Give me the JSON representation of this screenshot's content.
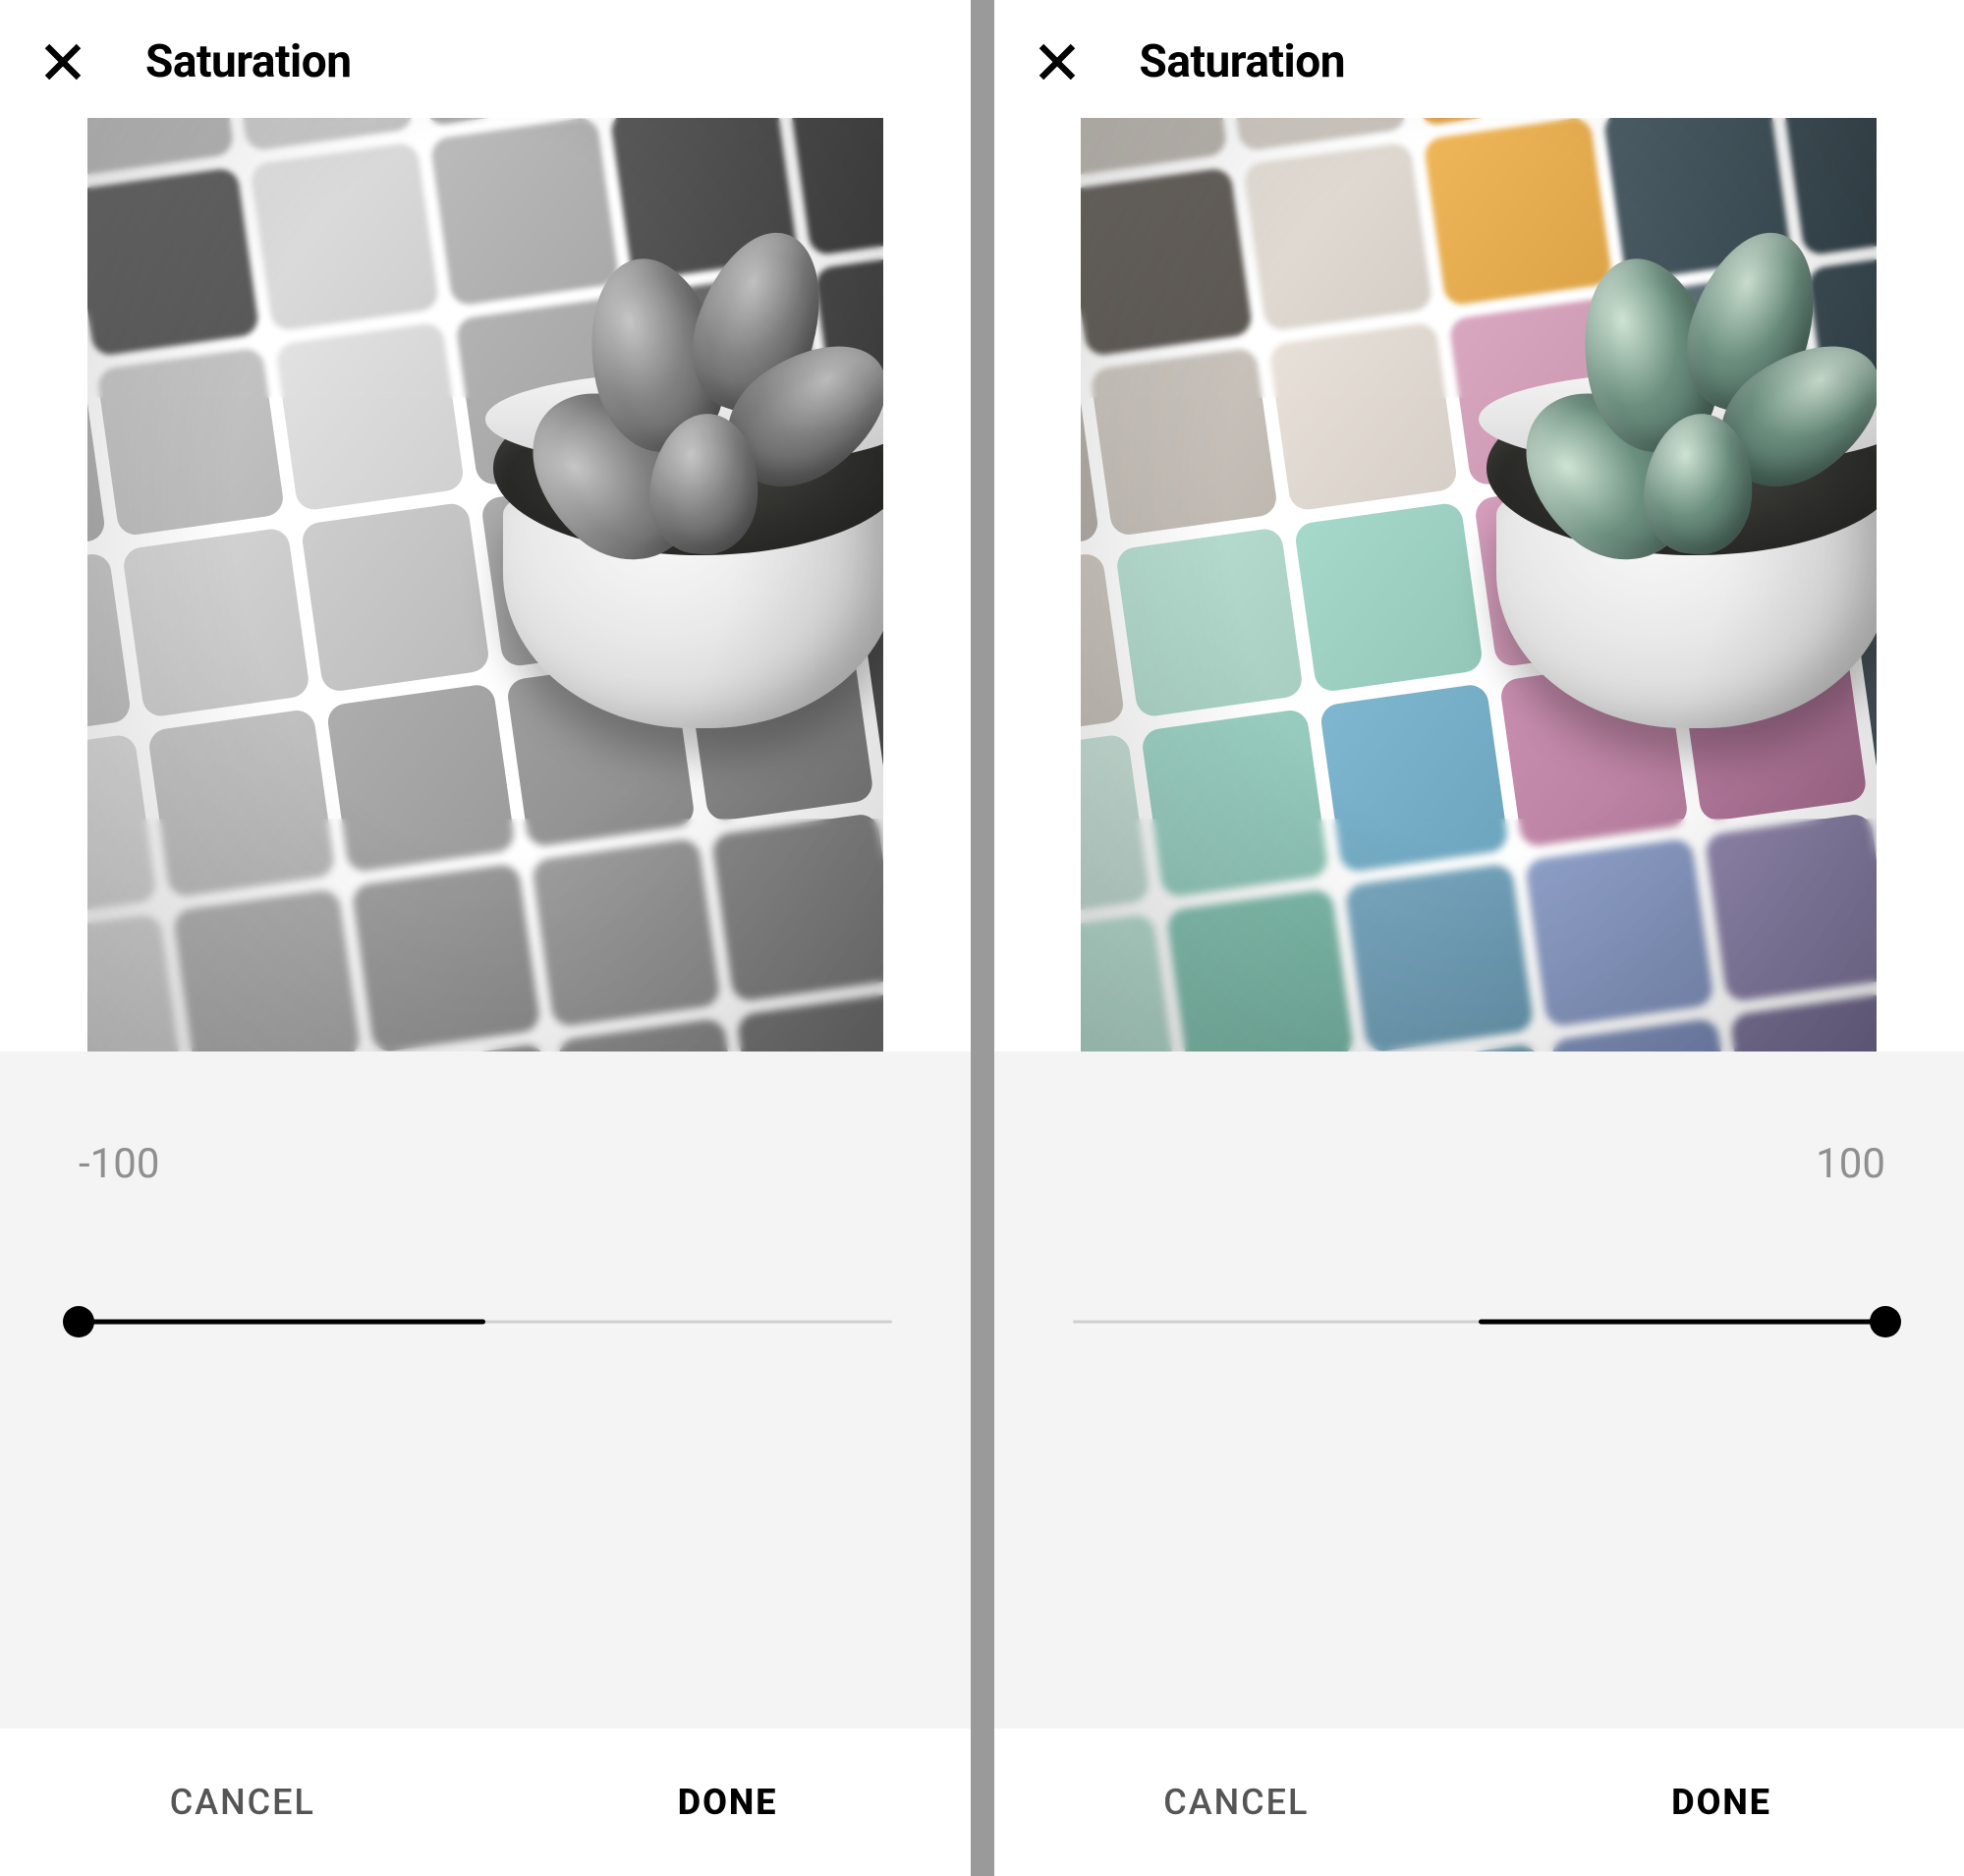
{
  "left": {
    "title": "Saturation",
    "value": "-100",
    "value_side": "left",
    "slider_percent": 0,
    "cancel_label": "CANCEL",
    "done_label": "DONE"
  },
  "right": {
    "title": "Saturation",
    "value": "100",
    "value_side": "right",
    "slider_percent": 100,
    "cancel_label": "CANCEL",
    "done_label": "DONE"
  },
  "tile_colors": [
    "#b7b2ad",
    "#cbc6c0",
    "#d9d3cc",
    "#e6a84e",
    "#e39a33",
    "#3a4a52",
    "#a9a49f",
    "#6f6a65",
    "#e6e0d8",
    "#efb659",
    "#4d5e66",
    "#415158",
    "#c6bfba",
    "#d0cac3",
    "#e8e1d9",
    "#d9a7c0",
    "#5f7077",
    "#3e4e55",
    "#d6d0c9",
    "#b9e0d3",
    "#a6d9ca",
    "#d59fbd",
    "#cf8fb0",
    "#556168",
    "#cfe8df",
    "#9fd4c6",
    "#7fb7d0",
    "#c98fb0",
    "#b97fa2",
    "#4a565d",
    "#bfe3d7",
    "#86c2b1",
    "#7aa8c0",
    "#8fa0c8",
    "#8f86ab",
    "#3f4950",
    "#a9d6c8",
    "#79b4a3",
    "#6c99b0",
    "#7f8fb8",
    "#7a7296",
    "#343d43"
  ],
  "leaf_color_gray": "#8e8e8e",
  "leaf_color_color": "#6b8f7e"
}
